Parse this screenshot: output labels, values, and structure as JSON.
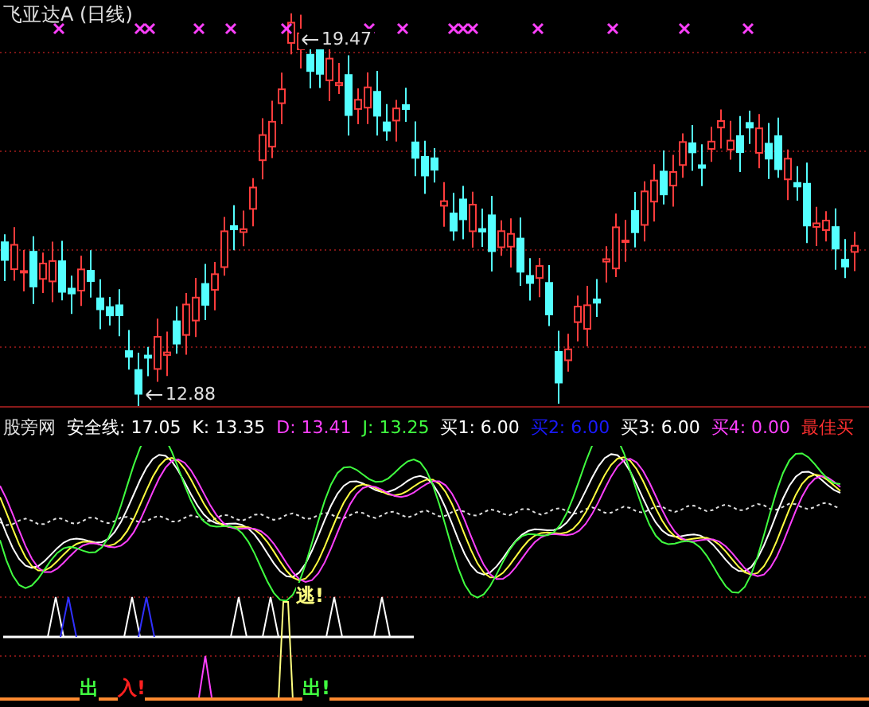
{
  "title": "飞亚达A (日线)",
  "price_marks": [
    {
      "kind": "high",
      "label": "19.47"
    },
    {
      "kind": "low",
      "label": "12.88"
    }
  ],
  "indicator": {
    "name": "股旁网",
    "values": [
      {
        "label": "安全线: 17.05",
        "color": "#ffffff"
      },
      {
        "label": "K: 13.35",
        "color": "#ffffff"
      },
      {
        "label": "D: 13.41",
        "color": "#ff40ff"
      },
      {
        "label": "J: 13.25",
        "color": "#40ff40"
      },
      {
        "label": "买1: 6.00",
        "color": "#ffffff"
      },
      {
        "label": "买2: 6.00",
        "color": "#1a1aff"
      },
      {
        "label": "买3: 6.00",
        "color": "#ffffff"
      },
      {
        "label": "买4: 0.00",
        "color": "#ff40ff"
      },
      {
        "label": "最佳买",
        "color": "#ff3030"
      }
    ]
  },
  "signals": [
    {
      "label": "逃!",
      "color": "#ffff80"
    },
    {
      "label": "出",
      "color": "#40ff40"
    },
    {
      "label": "入!",
      "color": "#ff2020"
    },
    {
      "label": "出!",
      "color": "#40ff40"
    }
  ]
}
